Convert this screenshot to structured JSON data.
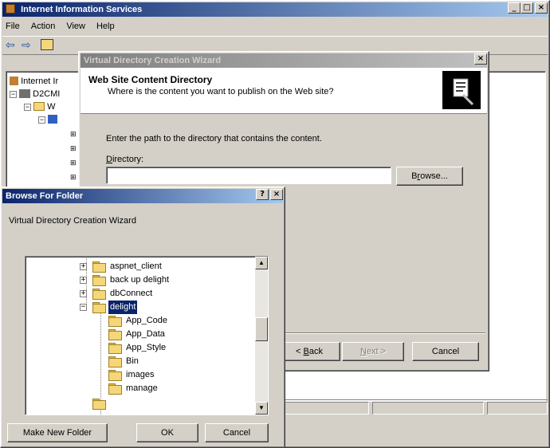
{
  "iis": {
    "title": "Internet Information Services",
    "menu": [
      "File",
      "Action",
      "View",
      "Help"
    ],
    "tree": [
      "Internet Ir",
      "D2CMI",
      "W"
    ]
  },
  "wizard": {
    "title": "Virtual Directory Creation Wizard",
    "header_title": "Web Site Content Directory",
    "header_subtitle": "Where is the content you want to publish on the Web site?",
    "instruction": "Enter the path to the directory that contains the content.",
    "directory_label_prefix": "",
    "directory_label_hotkey": "D",
    "directory_label_rest": "irectory:",
    "directory_value": "",
    "browse_hotkey": "r",
    "browse_pre": "B",
    "browse_post": "owse...",
    "back_pre": "< ",
    "back_hotkey": "B",
    "back_post": "ack",
    "next_hotkey": "N",
    "next_post": "ext >",
    "cancel_label": "Cancel"
  },
  "browse": {
    "title": "Browse For Folder",
    "description": "Virtual Directory Creation Wizard",
    "folders": [
      {
        "label": "aspnet_client",
        "level": 0,
        "expander": "+"
      },
      {
        "label": "back up delight",
        "level": 0,
        "expander": "+"
      },
      {
        "label": "dbConnect",
        "level": 0,
        "expander": "+"
      },
      {
        "label": "delight",
        "level": 0,
        "expander": "−",
        "selected": true
      },
      {
        "label": "App_Code",
        "level": 1
      },
      {
        "label": "App_Data",
        "level": 1
      },
      {
        "label": "App_Style",
        "level": 1
      },
      {
        "label": "Bin",
        "level": 1
      },
      {
        "label": "images",
        "level": 1
      },
      {
        "label": "manage",
        "level": 1
      }
    ],
    "make_new_folder": "Make New Folder",
    "ok": "OK",
    "cancel": "Cancel"
  }
}
